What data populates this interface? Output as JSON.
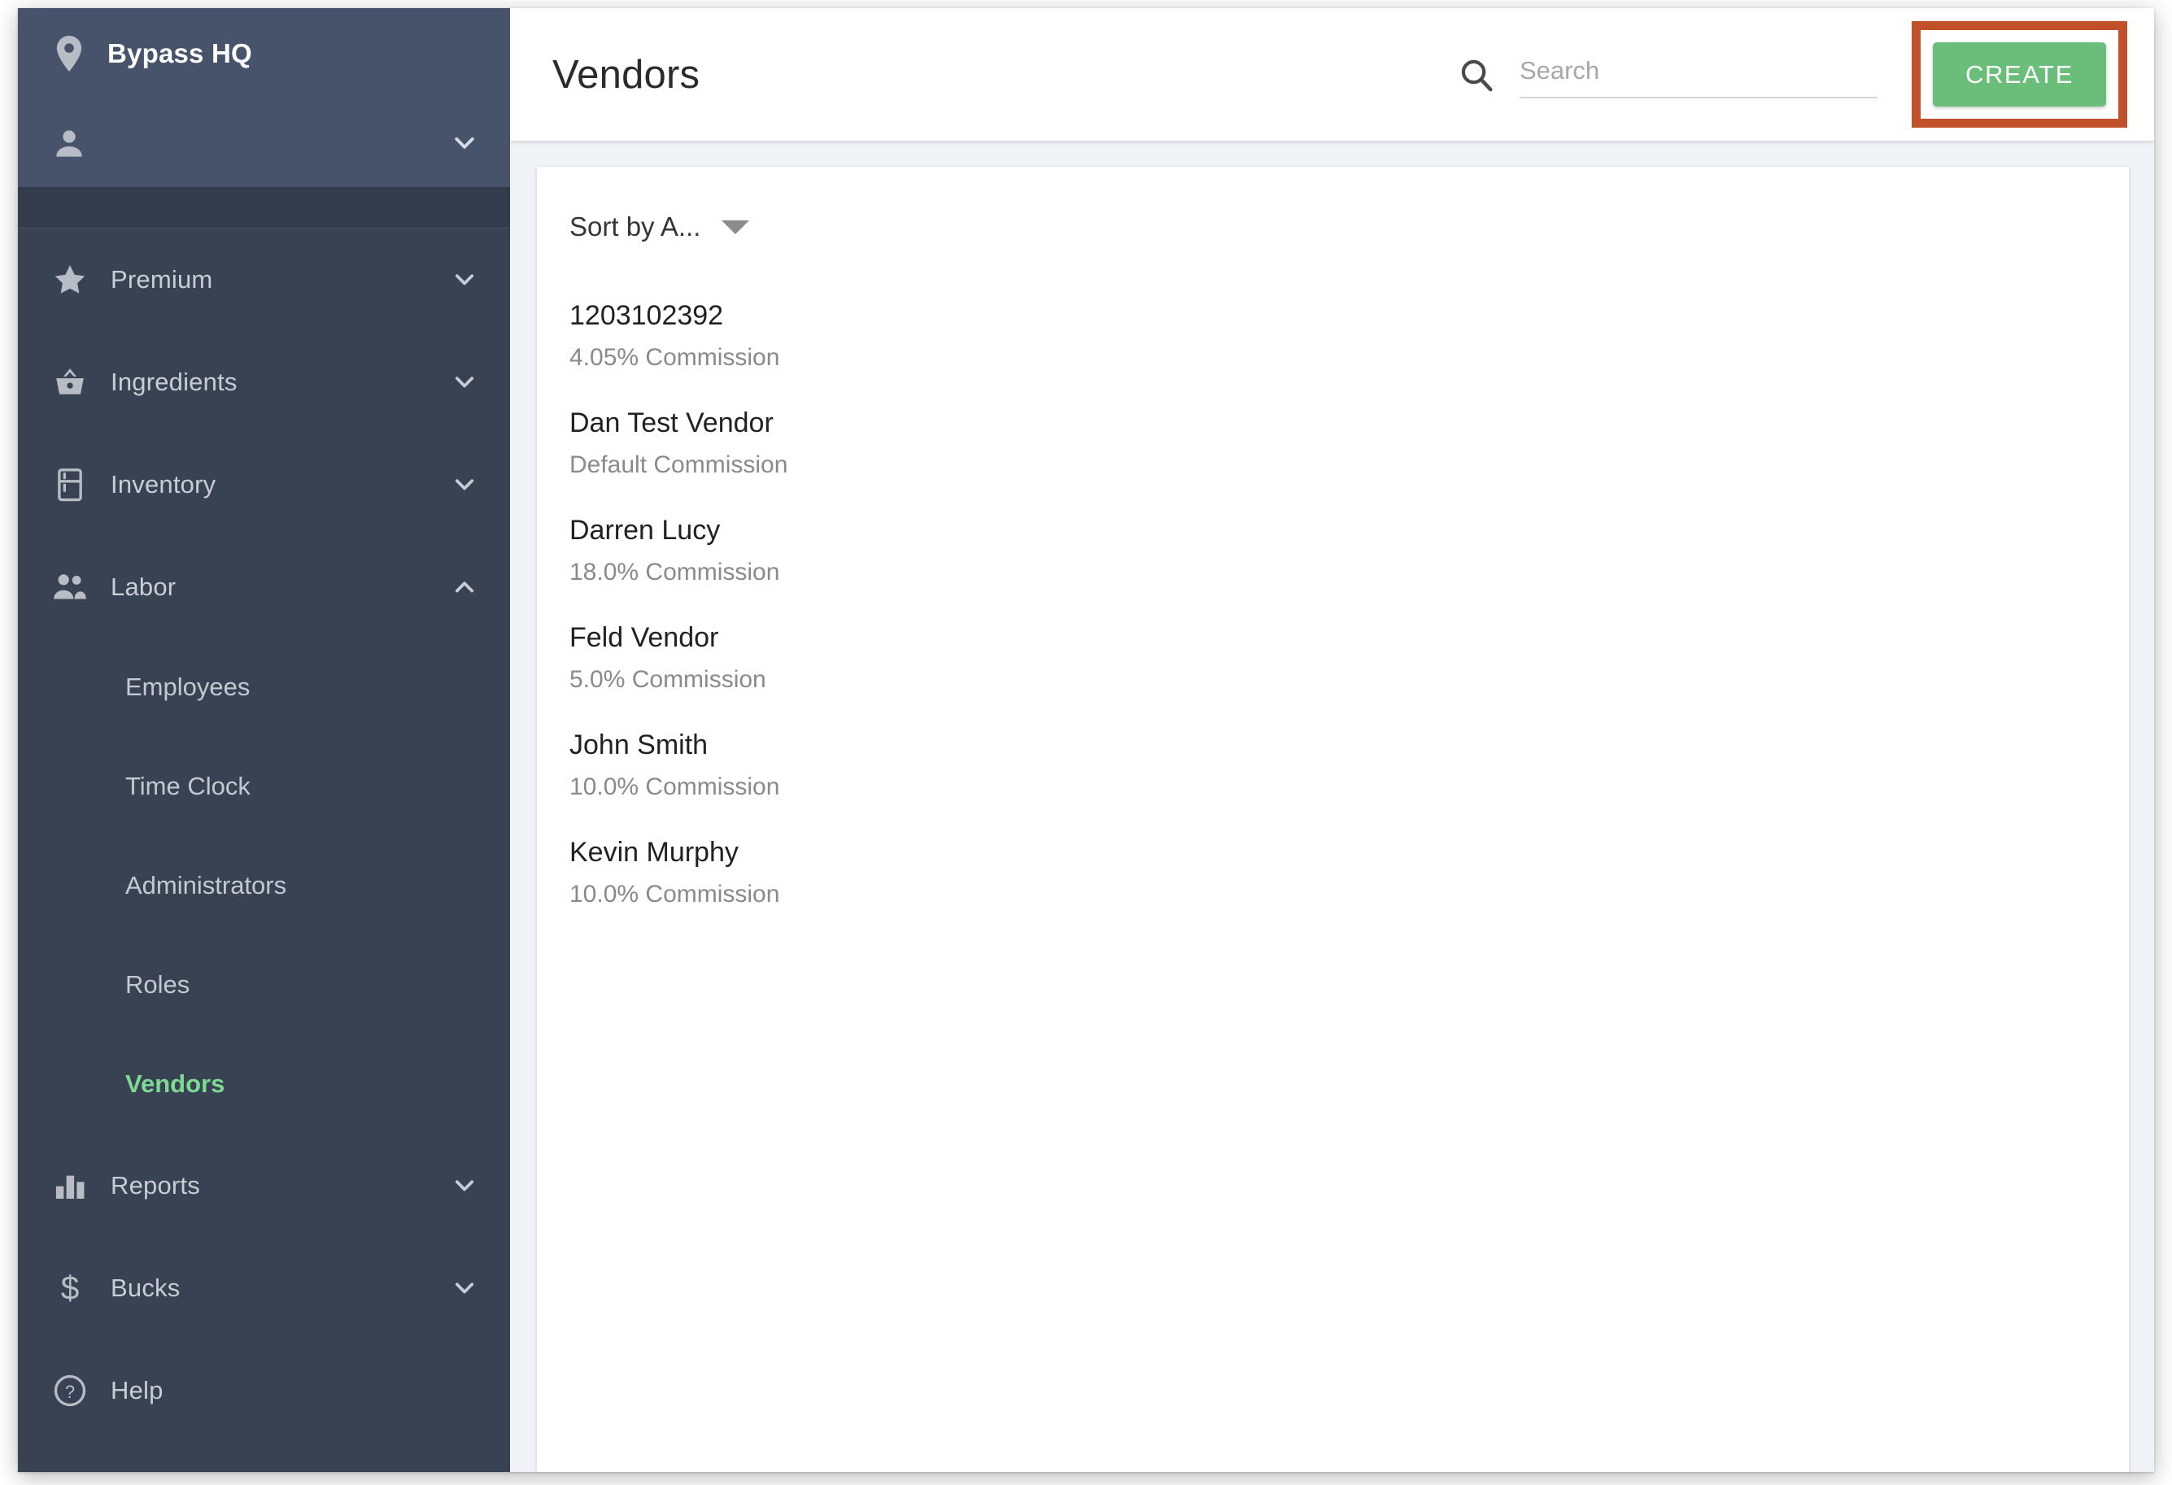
{
  "sidebar": {
    "brand": {
      "icon": "location-pin-icon",
      "name": "Bypass HQ"
    },
    "user": {
      "icon": "person-icon",
      "label": "",
      "chevron": "chevron-down-icon"
    },
    "nav": [
      {
        "label": "Premium",
        "icon": "star-icon",
        "chevron": "chevron-down-icon",
        "expanded": false
      },
      {
        "label": "Ingredients",
        "icon": "basket-icon",
        "chevron": "chevron-down-icon",
        "expanded": false
      },
      {
        "label": "Inventory",
        "icon": "refrigerator-icon",
        "chevron": "chevron-down-icon",
        "expanded": false
      },
      {
        "label": "Labor",
        "icon": "people-icon",
        "chevron": "chevron-up-icon",
        "expanded": true
      }
    ],
    "labor_subitems": [
      {
        "label": "Employees",
        "active": false
      },
      {
        "label": "Time Clock",
        "active": false
      },
      {
        "label": "Administrators",
        "active": false
      },
      {
        "label": "Roles",
        "active": false
      },
      {
        "label": "Vendors",
        "active": true
      }
    ],
    "nav_bottom": [
      {
        "label": "Reports",
        "icon": "bar-chart-icon",
        "chevron": "chevron-down-icon"
      },
      {
        "label": "Bucks",
        "icon": "dollar-icon",
        "chevron": "chevron-down-icon"
      },
      {
        "label": "Help",
        "icon": "help-circle-icon",
        "chevron": ""
      }
    ]
  },
  "topbar": {
    "title": "Vendors",
    "search": {
      "icon": "search-icon",
      "value": "",
      "placeholder": "Search"
    },
    "create_label": "CREATE"
  },
  "content": {
    "sort": {
      "label": "Sort by A...",
      "caret": "caret-down-icon"
    },
    "vendors": [
      {
        "name": "1203102392",
        "commission": "4.05% Commission"
      },
      {
        "name": "Dan Test Vendor",
        "commission": "Default Commission"
      },
      {
        "name": "Darren Lucy",
        "commission": "18.0% Commission"
      },
      {
        "name": "Feld Vendor",
        "commission": "5.0% Commission"
      },
      {
        "name": "John Smith",
        "commission": "10.0% Commission"
      },
      {
        "name": "Kevin Murphy",
        "commission": "10.0% Commission"
      }
    ]
  },
  "colors": {
    "sidebar_header": "#46536a",
    "sidebar_nav": "#394253",
    "sidebar_gap": "#333c4c",
    "active_green": "#7ed992",
    "create_green": "#6bbd7a",
    "annotation_orange": "#c0512a",
    "page_bg": "#f0f2f5"
  }
}
